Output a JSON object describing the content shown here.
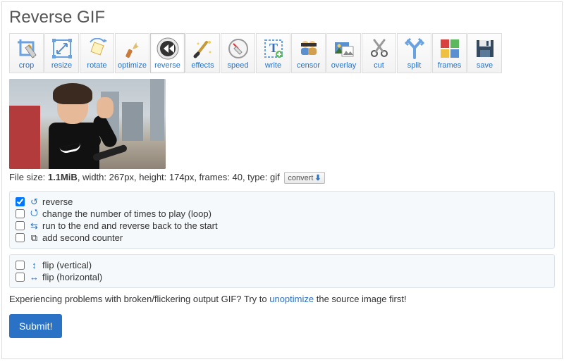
{
  "title": "Reverse GIF",
  "toolbar": [
    {
      "id": "crop",
      "label": "crop"
    },
    {
      "id": "resize",
      "label": "resize"
    },
    {
      "id": "rotate",
      "label": "rotate"
    },
    {
      "id": "optimize",
      "label": "optimize"
    },
    {
      "id": "reverse",
      "label": "reverse",
      "active": true
    },
    {
      "id": "effects",
      "label": "effects"
    },
    {
      "id": "speed",
      "label": "speed"
    },
    {
      "id": "write",
      "label": "write"
    },
    {
      "id": "censor",
      "label": "censor"
    },
    {
      "id": "overlay",
      "label": "overlay"
    },
    {
      "id": "cut",
      "label": "cut"
    },
    {
      "id": "split",
      "label": "split"
    },
    {
      "id": "frames",
      "label": "frames"
    },
    {
      "id": "save",
      "label": "save"
    }
  ],
  "file": {
    "size_label": "File size: ",
    "size_value": "1.1MiB",
    "rest": ", width: 267px, height: 174px, frames: 40, type: gif",
    "convert_label": "convert"
  },
  "options_a": [
    {
      "id": "reverse",
      "label": "reverse",
      "checked": true,
      "icon": "↺",
      "color": "#2a72c5"
    },
    {
      "id": "loop",
      "label": "change the number of times to play (loop)",
      "checked": false,
      "icon": "⭯",
      "color": "#2a72c5"
    },
    {
      "id": "pingpong",
      "label": "run to the end and reverse back to the start",
      "checked": false,
      "icon": "⇆",
      "color": "#2a72c5"
    },
    {
      "id": "counter",
      "label": "add second counter",
      "checked": false,
      "icon": "⧉",
      "color": "#333"
    }
  ],
  "options_b": [
    {
      "id": "flipv",
      "label": "flip (vertical)",
      "checked": false,
      "icon": "↕",
      "color": "#2a72c5"
    },
    {
      "id": "fliph",
      "label": "flip (horizontal)",
      "checked": false,
      "icon": "↔",
      "color": "#2a72c5"
    }
  ],
  "hint": {
    "pre": "Experiencing problems with broken/flickering output GIF? Try to ",
    "link": "unoptimize",
    "post": " the source image first!"
  },
  "submit_label": "Submit!"
}
